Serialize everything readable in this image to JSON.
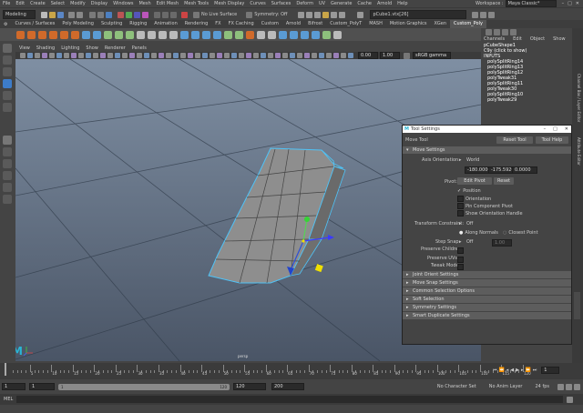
{
  "menubar": {
    "items": [
      "File",
      "Edit",
      "Create",
      "Select",
      "Modify",
      "Display",
      "Windows",
      "Mesh",
      "Edit Mesh",
      "Mesh Tools",
      "Mesh Display",
      "Curves",
      "Surfaces",
      "Deform",
      "UV",
      "Generate",
      "Cache",
      "Arnold",
      "Help"
    ],
    "workspace_label": "Workspace :",
    "workspace_value": "Maya Classic*"
  },
  "status": {
    "mode": "Modeling",
    "live_surface": "No Live Surface",
    "symmetry": "Symmetry: Off",
    "object_field": "pCube1.vtx[26]"
  },
  "shelf_tabs": [
    "Curves / Surfaces",
    "Poly Modeling",
    "Sculpting",
    "Rigging",
    "Animation",
    "Rendering",
    "FX",
    "FX Caching",
    "Custom",
    "Arnold",
    "Bifrost",
    "Custom_PolyT",
    "MASH",
    "Motion Graphics",
    "XGen",
    "Custom_Poly"
  ],
  "shelf_active": "Custom_Poly",
  "viewport": {
    "menu": [
      "View",
      "Shading",
      "Lighting",
      "Show",
      "Renderer",
      "Panels"
    ],
    "value_a": "0.00",
    "value_b": "1.00",
    "color_space": "sRGB gamma",
    "camera_label": "persp",
    "logo": "M"
  },
  "channel_box": {
    "menu": [
      "Channels",
      "Edit",
      "Object",
      "Show"
    ],
    "shape": "pCubeShape1",
    "node": "C9y (click to show)",
    "inputs_label": "INPUTS",
    "inputs": [
      "polySplitRing14",
      "polySplitRing13",
      "polySplitRing12",
      "polyTweak31",
      "polySplitRing11",
      "polyTweak30",
      "polySplitRing10",
      "polyTweak29"
    ],
    "side_tabs": [
      "Channel Box / Layer Editor",
      "Attribute Editor"
    ]
  },
  "tool_settings": {
    "title": "Tool Settings",
    "tool_name": "Move Tool",
    "reset_label": "Reset Tool",
    "help_label": "Tool Help",
    "section_open": "Move Settings",
    "axis_label": "Axis Orientation:",
    "axis_value": "World",
    "coords": [
      "-180.0000",
      "-175.5920",
      "0.0000"
    ],
    "pivot_label": "Pivot:",
    "edit_pivot": "Edit Pivot",
    "pivot_reset": "Reset",
    "position": "Position",
    "orientation": "Orientation",
    "pin_pivot": "Pin Component Pivot",
    "show_handle": "Show Orientation Handle",
    "transform_constraint_label": "Transform Constraint:",
    "transform_constraint_value": "Off",
    "along_normals": "Along Normals",
    "closest_point": "Closest Point",
    "step_snap_label": "Step Snap:",
    "step_snap_value": "Off",
    "step_snap_num": "1.00",
    "preserve_children": "Preserve Children:",
    "preserve_uvs": "Preserve UVs:",
    "tweak_mode": "Tweak Mode:",
    "sections": [
      "Joint Orient Settings",
      "Move Snap Settings",
      "Common Selection Options",
      "Soft Selection",
      "Symmetry Settings",
      "Smart Duplicate Settings"
    ]
  },
  "timeline": {
    "ticks": [
      "5",
      "10",
      "15",
      "20",
      "25",
      "30",
      "35",
      "40",
      "45",
      "50",
      "55",
      "60",
      "65",
      "70",
      "75",
      "80",
      "85",
      "90",
      "95",
      "100",
      "105",
      "110",
      "115",
      "120"
    ],
    "current_frame": "1"
  },
  "range": {
    "start": "1",
    "start2": "1",
    "range_start_field": "1",
    "range_end_field": "120",
    "end": "120",
    "end2": "200",
    "character_set": "No Character Set",
    "anim_layer": "No Anim Layer",
    "fps": "24 fps"
  },
  "cmdline": {
    "label": "MEL"
  }
}
